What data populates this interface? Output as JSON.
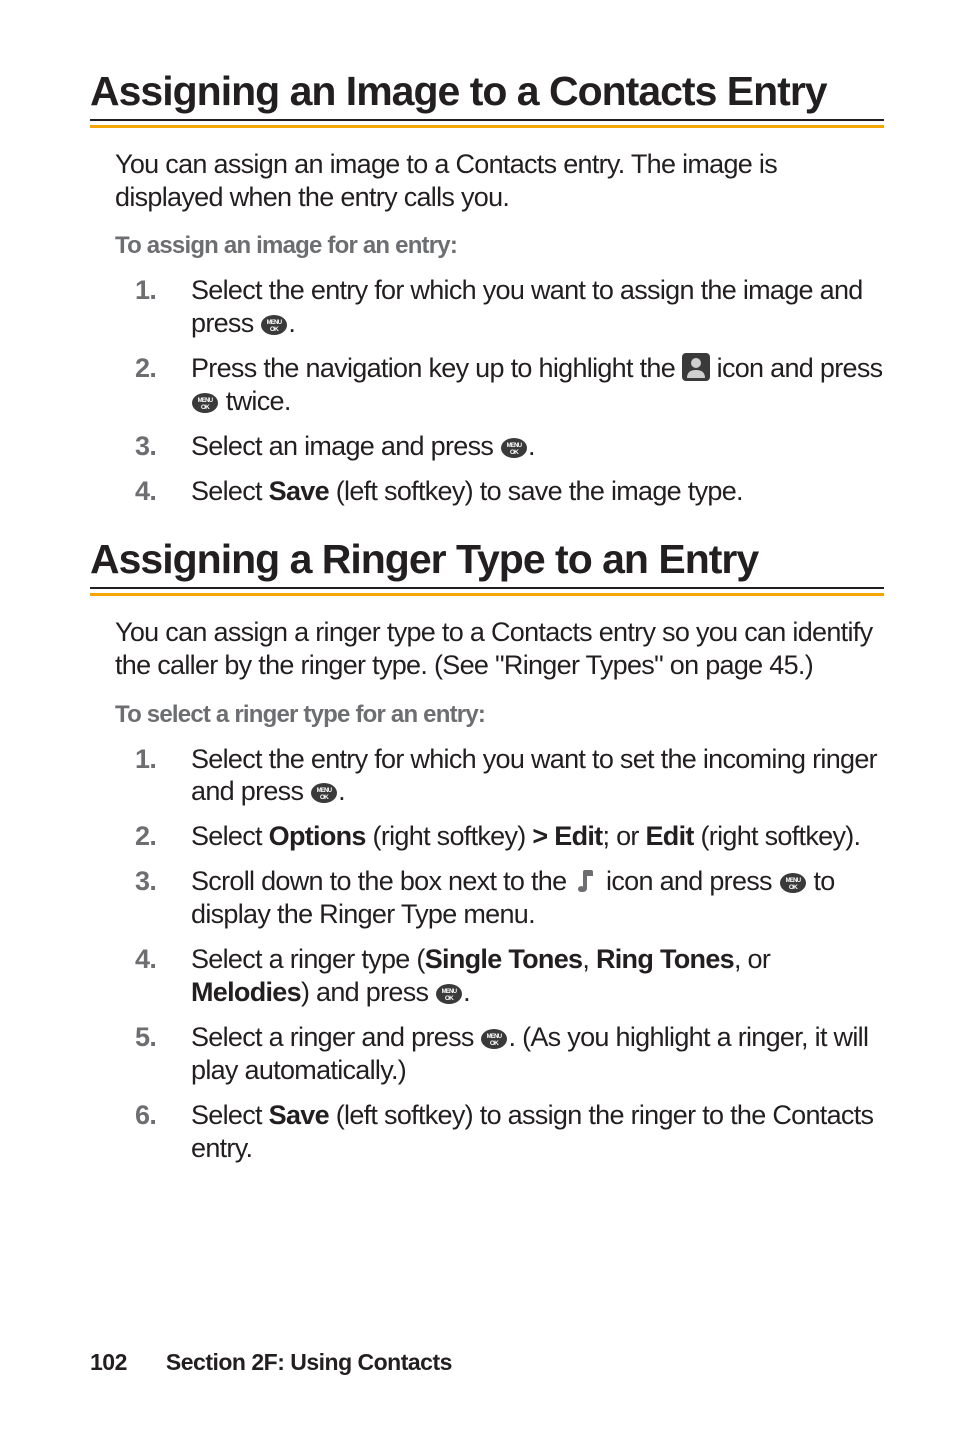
{
  "heading1": "Assigning an Image to a Contacts Entry",
  "intro1": "You can assign an image to a Contacts entry. The image is displayed when the entry calls you.",
  "sub1": "To assign an image for an entry:",
  "steps1": {
    "s1a": "Select the entry for which you want to assign the image and press ",
    "s1b": ".",
    "s2a": "Press the navigation key up to highlight the ",
    "s2b": " icon and press ",
    "s2c": " twice.",
    "s3a": "Select an image and press ",
    "s3b": ".",
    "s4a": "Select ",
    "s4bold": "Save",
    "s4b": " (left softkey) to save the image type."
  },
  "heading2": "Assigning a Ringer Type to an Entry",
  "intro2": "You can assign a ringer type to a Contacts entry so you can identify the caller by the ringer type. (See \"Ringer Types\" on page 45.)",
  "sub2": "To select a ringer type for an entry:",
  "steps2": {
    "s1a": "Select the entry for which you want to set the incoming ringer and press ",
    "s1b": ".",
    "s2a": "Select ",
    "s2b_bold": "Options",
    "s2c": " (right softkey) ",
    "s2d_bold": "> Edit",
    "s2e": "; or ",
    "s2f_bold": "Edit",
    "s2g": " (right softkey).",
    "s3a": "Scroll down to the box next to the ",
    "s3b": " icon and press ",
    "s3c": " to display the Ringer Type menu.",
    "s4a": "Select a ringer type (",
    "s4b_bold": "Single Tones",
    "s4c": ", ",
    "s4d_bold": "Ring Tones",
    "s4e": ", or ",
    "s4f_bold": "Melodies",
    "s4g": ") and press ",
    "s4h": ".",
    "s5a": "Select a ringer and press ",
    "s5b": ". (As you highlight a ringer, it will play automatically.)",
    "s6a": "Select ",
    "s6b_bold": "Save",
    "s6c": " (left softkey) to assign the ringer to the Contacts entry."
  },
  "footer_page": "102",
  "footer_text": "Section 2F: Using Contacts"
}
